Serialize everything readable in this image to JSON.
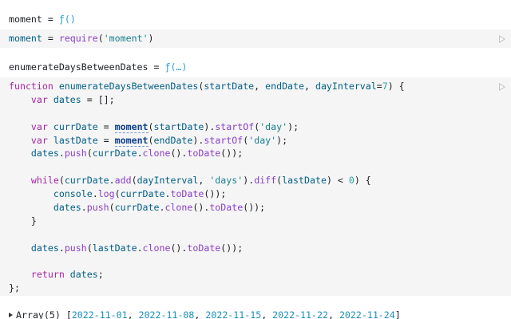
{
  "outputs": [
    {
      "name": "moment",
      "eq": " = ",
      "fn": "ƒ()"
    },
    {
      "name": "enumerateDaysBetweenDates",
      "eq": " = ",
      "fn": "ƒ(…)"
    }
  ],
  "cell1": {
    "code_var": "moment",
    "code_eq": " = ",
    "code_fn": "require",
    "code_open": "(",
    "code_str": "'moment'",
    "code_close": ")"
  },
  "cell2": {
    "t": {
      "function": "function",
      "enumerate": "enumerateDaysBetweenDates",
      "startDate": "startDate",
      "endDate": "endDate",
      "dayInterval": "dayInterval",
      "seven": "7",
      "var": "var",
      "dates": "dates",
      "currDate": "currDate",
      "lastDate": "lastDate",
      "moment": "moment",
      "startOf": "startOf",
      "day": "'day'",
      "push": "push",
      "clone": "clone",
      "toDate": "toDate",
      "while": "while",
      "add": "add",
      "days": "'days'",
      "diff": "diff",
      "zero": "0",
      "console": "console",
      "log": "log",
      "return": "return"
    }
  },
  "array": {
    "label": "Array(5)",
    "open": " [",
    "items": [
      "2022-11-01",
      "2022-11-08",
      "2022-11-15",
      "2022-11-22",
      "2022-11-24"
    ],
    "sep": ", ",
    "close": "]"
  },
  "icons": {
    "run": "play-icon",
    "expand": "caret-right-icon"
  }
}
